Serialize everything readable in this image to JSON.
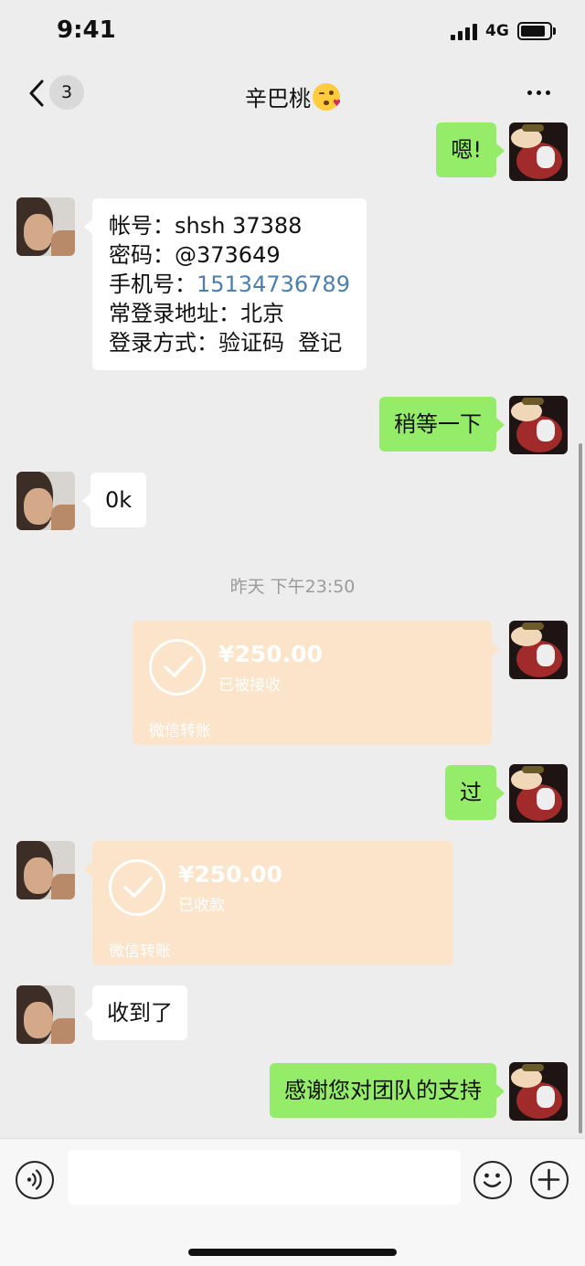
{
  "status_bar": {
    "time": "9:41",
    "network": "4G"
  },
  "header": {
    "back_count": "3",
    "title": "辛巴桃",
    "title_emoji": "face-blowing-kiss",
    "more_icon": "ellipsis-icon"
  },
  "messages": [
    {
      "side": "right",
      "type": "text",
      "text": "嗯!"
    },
    {
      "side": "left",
      "type": "text",
      "lines": [
        "帐号：shsh 37388",
        "密码：@373649",
        {
          "label": "手机号：",
          "link": "15134736789"
        },
        "常登录地址：北京",
        "登录方式：验证码  登记"
      ]
    },
    {
      "side": "right",
      "type": "text",
      "text": "稍等一下"
    },
    {
      "side": "left",
      "type": "text",
      "text": "0k"
    },
    {
      "type": "timestamp",
      "text": "昨天 下午23:50"
    },
    {
      "side": "right",
      "type": "transfer",
      "amount": "¥250.00",
      "status": "已被接收",
      "label": "微信转账"
    },
    {
      "side": "right",
      "type": "text",
      "text": "过"
    },
    {
      "side": "left",
      "type": "transfer",
      "amount": "¥250.00",
      "status": "已收款",
      "label": "微信转账"
    },
    {
      "side": "left",
      "type": "text",
      "text": "收到了"
    },
    {
      "side": "right",
      "type": "text",
      "text": "感谢您对团队的支持"
    }
  ],
  "input_bar": {
    "voice_icon": "voice-icon",
    "text_value": "",
    "emoji_icon": "emoji-icon",
    "plus_icon": "plus-icon"
  },
  "colors": {
    "background": "#ededed",
    "self_bubble": "#95ec69",
    "other_bubble": "#ffffff",
    "transfer_bubble": "#fbe4c9",
    "link": "#4a7fae"
  }
}
